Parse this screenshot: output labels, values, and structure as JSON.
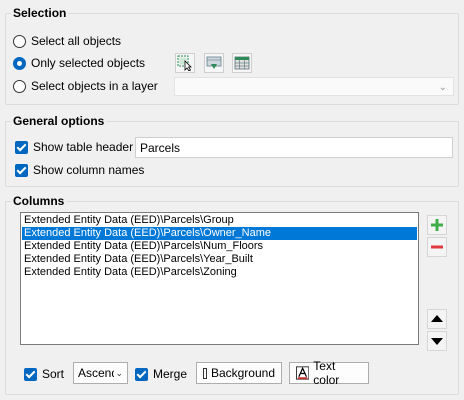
{
  "selection": {
    "title": "Selection",
    "options": [
      {
        "label": "Select all objects",
        "checked": false
      },
      {
        "label": "Only selected objects",
        "checked": true
      },
      {
        "label": "Select objects in a layer",
        "checked": false
      }
    ],
    "layer_value": ""
  },
  "general": {
    "title": "General options",
    "show_table_header_label": "Show table header",
    "table_header_value": "Parcels",
    "show_column_names_label": "Show column names"
  },
  "columns": {
    "title": "Columns",
    "items": [
      "Extended Entity Data (EED)\\Parcels\\Group",
      "Extended Entity Data (EED)\\Parcels\\Owner_Name",
      "Extended Entity Data (EED)\\Parcels\\Num_Floors",
      "Extended Entity Data (EED)\\Parcels\\Year_Built",
      "Extended Entity Data (EED)\\Parcels\\Zoning"
    ],
    "selected_index": 1
  },
  "footer": {
    "sort_label": "Sort",
    "sort_value": "Ascending",
    "merge_label": "Merge",
    "background_label": "Background",
    "text_color_label": "Text color"
  },
  "colors": {
    "accent": "#0067c0",
    "selection": "#0078d7",
    "add_green": "#3fae49",
    "remove_red": "#e0393e"
  },
  "icons": {
    "select_pick": "pick-cursor-icon",
    "select_filter": "filter-icon",
    "select_table": "table-icon",
    "add": "plus-icon",
    "remove": "minus-icon",
    "up": "triangle-up-icon",
    "down": "triangle-down-icon"
  }
}
